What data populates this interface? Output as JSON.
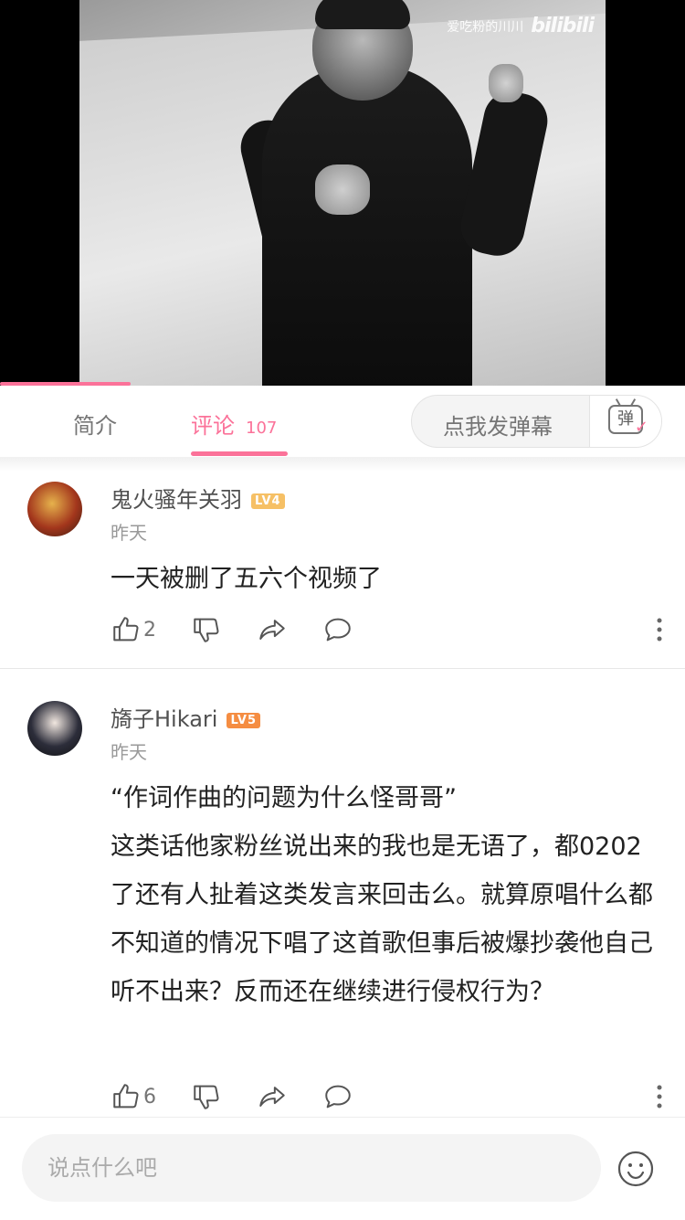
{
  "video": {
    "watermark_user": "爱吃粉的川川",
    "watermark_logo": "bilibili",
    "progress": 0.19
  },
  "tabs": {
    "intro_label": "简介",
    "comments_label": "评论",
    "comments_count": "107",
    "danmaku_placeholder": "点我发弹幕",
    "danmaku_icon_char": "弹"
  },
  "comments": [
    {
      "username": "鬼火骚年关羽",
      "level": "LV4",
      "date": "昨天",
      "text": "一天被删了五六个视频了",
      "likes": "2"
    },
    {
      "username": "旖子Hikari",
      "level": "LV5",
      "date": "昨天",
      "text": "“作词作曲的问题为什么怪哥哥”\n这类话他家粉丝说出来的我也是无语了，都0202了还有人扯着这类发言来回击么。就算原唱什么都不知道的情况下唱了这首歌但事后被爆抄袭他自己听不出来？反而还在继续进行侵权行为？",
      "likes": "6"
    }
  ],
  "compose": {
    "placeholder": "说点什么吧"
  },
  "colors": {
    "accent": "#fb7299",
    "lv4": "#f6c065",
    "lv5": "#f58d42"
  }
}
